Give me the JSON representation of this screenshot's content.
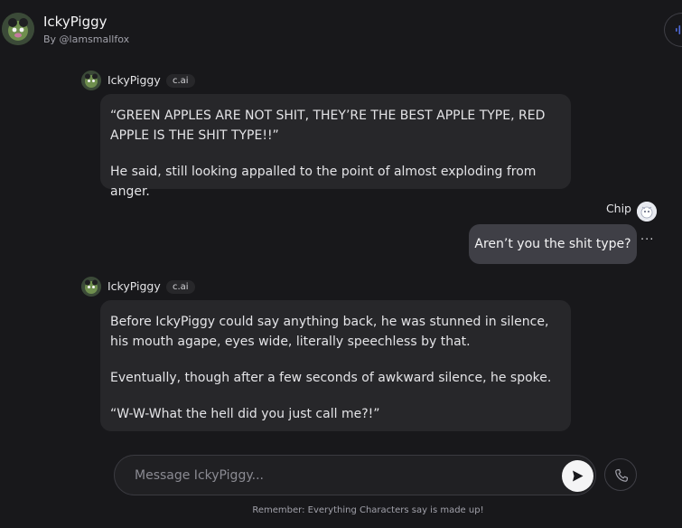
{
  "header": {
    "title": "IckyPiggy",
    "subtitle": "By @lamsmallfox",
    "icons": {
      "avatar": "character-avatar",
      "voice": "voice-waveform-icon"
    }
  },
  "messages": [
    {
      "sender": "IckyPiggy",
      "badge": "c.ai",
      "paragraphs": [
        "“GREEN APPLES ARE NOT SHIT, THEY’RE THE BEST APPLE TYPE, RED APPLE IS THE SHIT TYPE!!”",
        "He said, still looking appalled to the point of almost exploding from anger."
      ]
    },
    {
      "sender": "Chip",
      "text": "Aren’t you the shit type?",
      "more": "···"
    },
    {
      "sender": "IckyPiggy",
      "badge": "c.ai",
      "paragraphs": [
        "Before IckyPiggy could say anything back, he was stunned in silence, his mouth agape, eyes wide, literally speechless by that.",
        "Eventually, though after a few seconds of awkward silence, he spoke.",
        "“W-W-What the hell did you just call me?!”"
      ]
    }
  ],
  "composer": {
    "placeholder": "Message IckyPiggy...",
    "value": "",
    "icons": {
      "send": "send-icon",
      "call": "phone-icon"
    }
  },
  "disclaimer": "Remember: Everything Characters say is made up!",
  "colors": {
    "background": "#18181b",
    "bubble": "#27272a",
    "user_bubble": "#3f3f46",
    "voice_accent": "#4f6bdc"
  }
}
